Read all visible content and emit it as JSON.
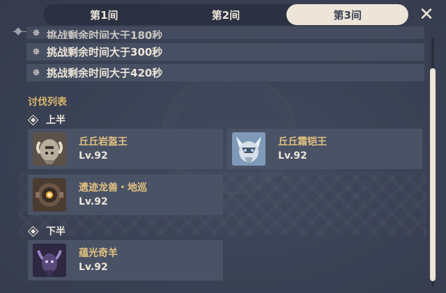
{
  "tabs": [
    {
      "label": "第1间",
      "active": false
    },
    {
      "label": "第2间",
      "active": false
    },
    {
      "label": "第3间",
      "active": true
    }
  ],
  "close_icon": "close-icon",
  "conditions": [
    {
      "text": "挑战剩余时间大于180秒",
      "partial": true
    },
    {
      "text": "挑战剩余时间大于300秒",
      "partial": false
    },
    {
      "text": "挑战剩余时间大于420秒",
      "partial": false
    }
  ],
  "enemy_list_title": "讨伐列表",
  "first_half": {
    "label": "上半",
    "enemies": [
      {
        "name": "丘丘岩盔王",
        "level": "Lv.92"
      },
      {
        "name": "丘丘霜铠王",
        "level": "Lv.92"
      },
      {
        "name": "遗迹龙兽・地巡",
        "level": "Lv.92"
      }
    ]
  },
  "second_half": {
    "label": "下半",
    "enemies": [
      {
        "name": "蕴光奇羊",
        "level": "Lv.92"
      }
    ]
  },
  "colors": {
    "background": "#3b4255",
    "accent_cream": "#ece5d8",
    "name_gold": "#e3c280",
    "section_gold": "#d8b56e"
  }
}
